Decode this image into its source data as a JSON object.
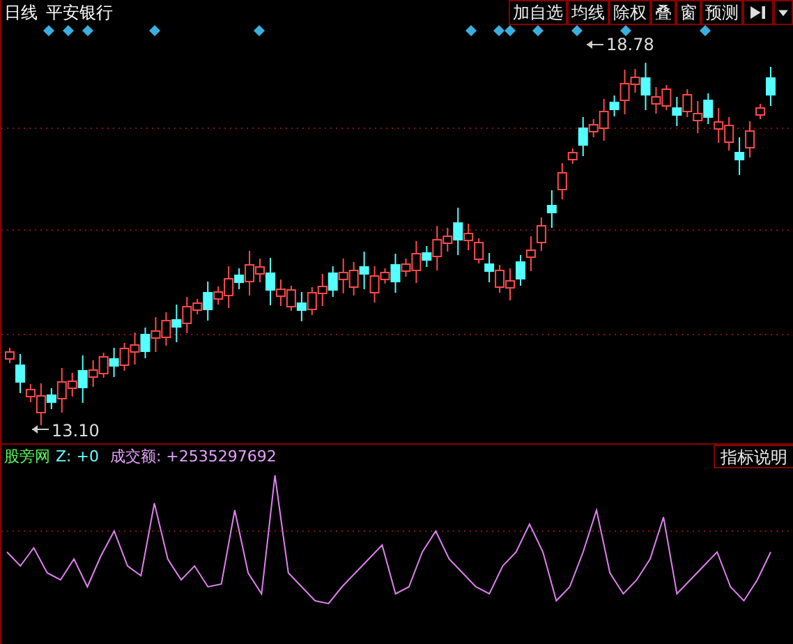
{
  "toolbar": {
    "period": "日线",
    "stock_name": "平安银行",
    "buttons": [
      {
        "label": "加自选"
      },
      {
        "label": "均线"
      },
      {
        "label": "除权"
      },
      {
        "label": "叠"
      },
      {
        "label": "窗"
      },
      {
        "label": "预测"
      }
    ]
  },
  "chart": {
    "high_label": "18.78",
    "low_label": "13.10"
  },
  "indicator": {
    "name": "股旁网",
    "z_label": "Z: +0",
    "volume_label": "成交额: +2535297692",
    "help_button": "指标说明"
  }
}
